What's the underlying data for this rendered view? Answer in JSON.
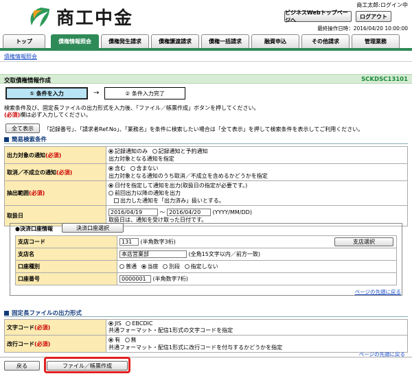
{
  "header": {
    "logo_text": "商工中金",
    "user_line": "商工太郎:ログイン中",
    "btn_top_page": "ビジネスWebトップページへ",
    "btn_logout": "ログアウト",
    "last_operation": "最終操作日時：2016/04/20 10:00:00"
  },
  "tabs": [
    "トップ",
    "債権情報照会",
    "債権発生請求",
    "債権譲渡請求",
    "債権一括請求",
    "融資申込",
    "その他請求",
    "管理業務"
  ],
  "active_tab": 1,
  "sublink": "債権情報照会",
  "title": {
    "text": "交取債権情報作成",
    "screen_id": "SCKDSC13101"
  },
  "steps": {
    "step1": "① 条件を入力",
    "arrow": "→",
    "step2": "② 条件入力完了"
  },
  "instructions": {
    "line1": "検索条件及び、固定長ファイルの出力形式を入力後、「ファイル／帳票作成」ボタンを押してください。",
    "line2_req": "(必須)",
    "line2_rest": "欄は必ず入力してください。"
  },
  "show_all": {
    "button": "全て表示",
    "note": "「記録番号」、「請求者Ref.No」、「業務名」を条件に検索したい場合は「全て表示」を押して検索条件を表示してご利用ください。"
  },
  "search_section": {
    "heading": "簡易検索条件",
    "req": "(必須)",
    "rows": {
      "notice_target": {
        "label": "出力対象の通知",
        "opt1": "記録通知のみ",
        "opt2": "記録通知と予約通知",
        "help": "出力対象となる通知を指定"
      },
      "unestablished": {
        "label": "取消／不成立の通知",
        "opt1": "含む",
        "opt2": "含まない",
        "help": "出力対象となる通知のうち取消／不成立を含めるかどうかを指定"
      },
      "range": {
        "label": "抽出範囲",
        "opt1": "日付を指定して通知を出力(取扱日の指定が必要です。)",
        "opt2": "前回出力以降の通知を出力",
        "check": "出力した通知を「出力済み」扱いとする。"
      },
      "handling_date": {
        "label": "取扱日",
        "from": "2016/04/19",
        "sep": "～",
        "to": "2016/04/20",
        "format": "(YYYY/MM/DD)",
        "help": "取扱日は、通知を受け取った日付です。"
      }
    },
    "account": {
      "heading": "●決済口座情報",
      "select_button": "決済口座選択",
      "branch_code_label": "支店コード",
      "branch_code_value": "131",
      "branch_code_note": "(半角数字3桁)",
      "branch_select_button": "支店選択",
      "branch_name_label": "支店名",
      "branch_name_value": "本店営業部",
      "branch_name_note": "(全角15文字以内／前方一致)",
      "type_label": "口座種別",
      "type_opts": [
        "普通",
        "当座",
        "別段",
        "指定しない"
      ],
      "number_label": "口座番号",
      "number_value": "0000001",
      "number_note": "(半角数字7桁)"
    },
    "page_top": "ページの先頭に戻る"
  },
  "file_section": {
    "heading": "固定長ファイルの出力形式",
    "charset": {
      "label": "文字コード",
      "opt1": "JIS",
      "opt2": "EBCDIC",
      "help": "共通フォーマット・配信1形式の文字コードを指定"
    },
    "newline": {
      "label": "改行コード",
      "opt1": "有",
      "opt2": "無",
      "help": "共通フォーマット・配信1形式に改行コードを付与するかどうかを指定"
    },
    "page_top": "ページの先頭に戻る"
  },
  "footer": {
    "back_button": "戻る",
    "create_button": "ファイル／帳票作成"
  },
  "colors": {
    "active_tab": "#2e8a57",
    "label_bg": "#fcebb3",
    "required": "#cc0000",
    "highlight": "#e02020"
  }
}
